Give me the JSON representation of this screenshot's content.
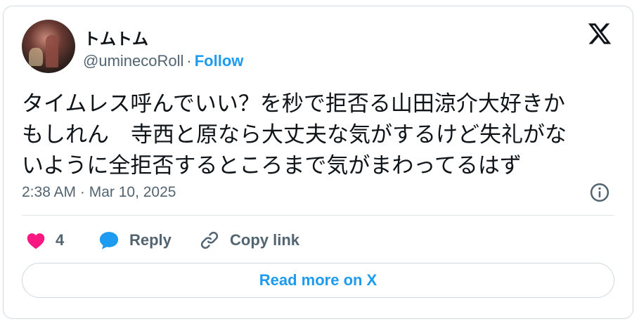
{
  "author": {
    "display_name": "トムトム",
    "handle": "@uminecoRoll",
    "separator": "·",
    "follow_label": "Follow"
  },
  "tweet": {
    "text": "タイムレス呼んでいい？を秒で拒否る山田涼介大好きか\nもしれん　寺西と原なら大丈夫な気がするけど失礼がな\nいように全拒否するところまで気がまわってるはず",
    "timestamp": "2:38 AM · Mar 10, 2025"
  },
  "actions": {
    "like_count": "4",
    "reply_label": "Reply",
    "copy_link_label": "Copy link"
  },
  "read_more_label": "Read more on X",
  "icons": {
    "brand": "x-logo-icon",
    "info": "info-icon",
    "like": "heart-icon",
    "reply": "speech-bubble-icon",
    "copy": "link-icon"
  },
  "colors": {
    "accent": "#1d9bf0",
    "like": "#f91880",
    "text": "#0f1419",
    "muted": "#536471",
    "border": "#cfd9de"
  }
}
